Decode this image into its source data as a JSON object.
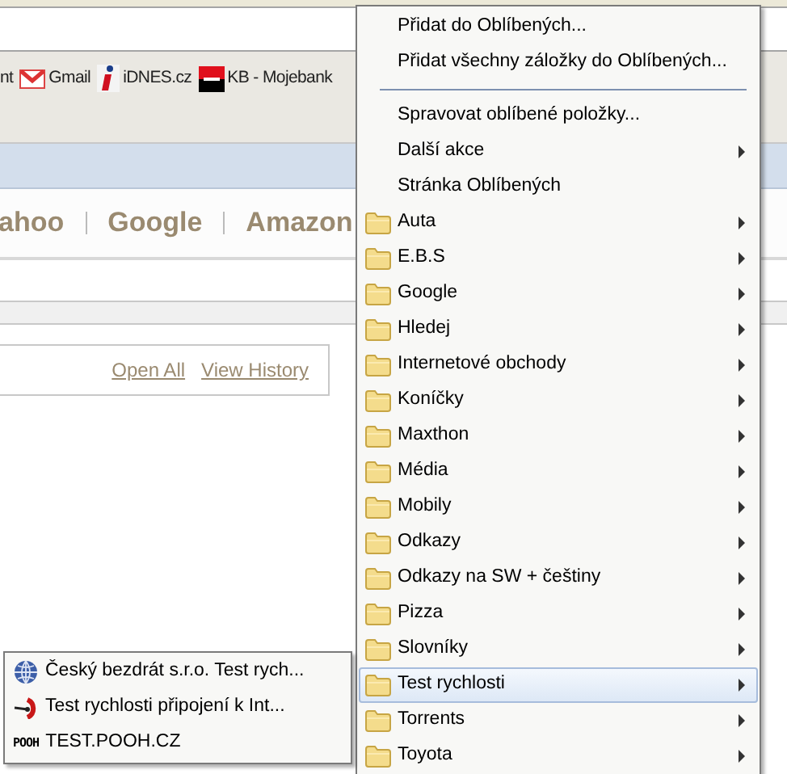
{
  "bookmarks": [
    {
      "kind": "none",
      "label": "nt"
    },
    {
      "kind": "mail",
      "label": "Gmail"
    },
    {
      "kind": "info",
      "label": "iDNES.cz"
    },
    {
      "kind": "bank",
      "label": "KB - Mojebank"
    }
  ],
  "search_links": [
    "ahoo",
    "Google",
    "Amazon"
  ],
  "history_links": [
    "Open All",
    "View History"
  ],
  "favorites_menu": [
    {
      "kind": "command",
      "label": "Přidat do Oblíbených...",
      "submenu": false,
      "selected": false
    },
    {
      "kind": "command",
      "label": "Přidat všechny záložky do Oblíbených...",
      "submenu": false,
      "selected": false
    },
    {
      "kind": "separator"
    },
    {
      "kind": "command",
      "label": "Spravovat oblíbené položky...",
      "submenu": false,
      "selected": false
    },
    {
      "kind": "command",
      "label": "Další akce",
      "submenu": true,
      "selected": false
    },
    {
      "kind": "command",
      "label": "Stránka Oblíbených",
      "submenu": false,
      "selected": false
    },
    {
      "kind": "folder",
      "label": "Auta",
      "submenu": true,
      "selected": false
    },
    {
      "kind": "folder",
      "label": "E.B.S",
      "submenu": true,
      "selected": false
    },
    {
      "kind": "folder",
      "label": "Google",
      "submenu": true,
      "selected": false
    },
    {
      "kind": "folder",
      "label": "Hledej",
      "submenu": true,
      "selected": false
    },
    {
      "kind": "folder",
      "label": "Internetové obchody",
      "submenu": true,
      "selected": false
    },
    {
      "kind": "folder",
      "label": "Koníčky",
      "submenu": true,
      "selected": false
    },
    {
      "kind": "folder",
      "label": "Maxthon",
      "submenu": true,
      "selected": false
    },
    {
      "kind": "folder",
      "label": "Média",
      "submenu": true,
      "selected": false
    },
    {
      "kind": "folder",
      "label": "Mobily",
      "submenu": true,
      "selected": false
    },
    {
      "kind": "folder",
      "label": "Odkazy",
      "submenu": true,
      "selected": false
    },
    {
      "kind": "folder",
      "label": "Odkazy na SW + češtiny",
      "submenu": true,
      "selected": false
    },
    {
      "kind": "folder",
      "label": "Pizza",
      "submenu": true,
      "selected": false
    },
    {
      "kind": "folder",
      "label": "Slovníky",
      "submenu": true,
      "selected": false
    },
    {
      "kind": "folder",
      "label": "Test rychlosti",
      "submenu": true,
      "selected": true
    },
    {
      "kind": "folder",
      "label": "Torrents",
      "submenu": true,
      "selected": false
    },
    {
      "kind": "folder",
      "label": "Toyota",
      "submenu": true,
      "selected": false
    }
  ],
  "submenu": [
    {
      "kind": "globe",
      "label": "Český bezdrát s.r.o. Test rych..."
    },
    {
      "kind": "gauge",
      "label": "Test rychlosti připojení k Int..."
    },
    {
      "kind": "text-logo",
      "logo": "POOH",
      "label": "TEST.POOH.CZ"
    }
  ]
}
